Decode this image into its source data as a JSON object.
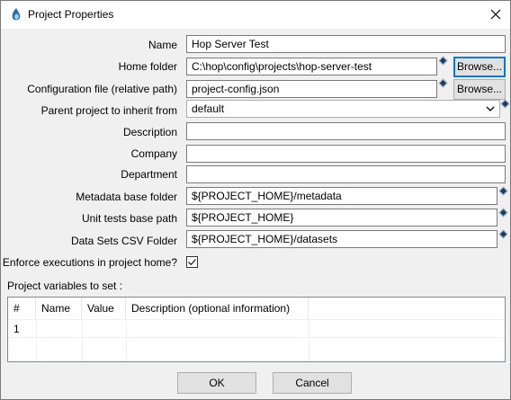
{
  "window": {
    "title": "Project Properties"
  },
  "form": {
    "name_label": "Name",
    "name_value": "Hop Server Test",
    "home_label": "Home folder",
    "home_value": "C:\\hop\\config\\projects\\hop-server-test",
    "config_label": "Configuration file (relative path)",
    "config_value": "project-config.json",
    "parent_label": "Parent project to inherit from",
    "parent_value": "default",
    "description_label": "Description",
    "description_value": "",
    "company_label": "Company",
    "company_value": "",
    "department_label": "Department",
    "department_value": "",
    "metadata_label": "Metadata base folder",
    "metadata_value": "${PROJECT_HOME}/metadata",
    "unit_tests_label": "Unit tests base path",
    "unit_tests_value": "${PROJECT_HOME}",
    "datasets_label": "Data Sets CSV Folder",
    "datasets_value": "${PROJECT_HOME}/datasets",
    "enforce_label": "Enforce executions in project home?",
    "enforce_checked": true,
    "browse_label": "Browse..."
  },
  "variables": {
    "section_label": "Project variables to set :",
    "columns": [
      "#",
      "Name",
      "Value",
      "Description (optional information)"
    ],
    "rows": [
      [
        "1",
        "",
        "",
        ""
      ]
    ]
  },
  "buttons": {
    "ok": "OK",
    "cancel": "Cancel"
  },
  "icons": {
    "app": "hop-logo-icon",
    "close": "close-icon",
    "variable": "variable-diamond-icon",
    "combo_arrow": "chevron-down-icon",
    "check": "checkmark-icon"
  },
  "colors": {
    "focus_border": "#0078d7",
    "variable_marker": "#1b3a5c"
  }
}
